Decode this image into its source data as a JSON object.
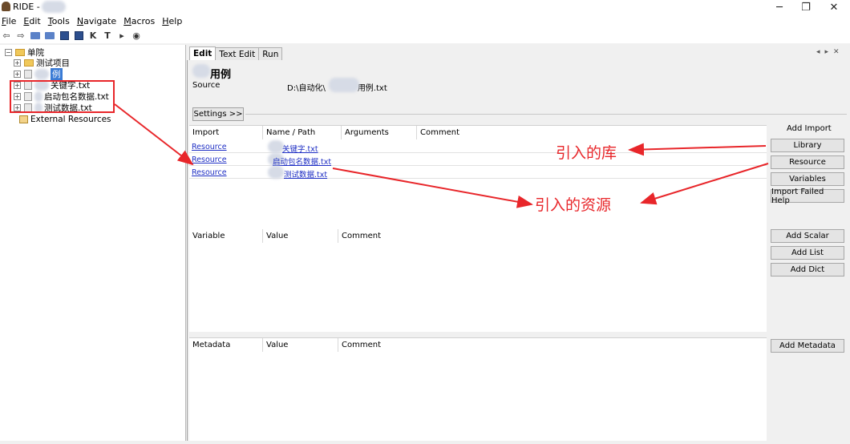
{
  "window": {
    "title": "RIDE - ",
    "controls": [
      "minimize-icon",
      "restore-icon",
      "close-icon"
    ]
  },
  "menu": {
    "items": [
      {
        "label": "File",
        "key": "F",
        "rest": "ile"
      },
      {
        "label": "Edit",
        "key": "E",
        "rest": "dit"
      },
      {
        "label": "Tools",
        "key": "T",
        "rest": "ools"
      },
      {
        "label": "Navigate",
        "key": "N",
        "rest": "avigate"
      },
      {
        "label": "Macros",
        "key": "M",
        "rest": "acros"
      },
      {
        "label": "Help",
        "key": "H",
        "rest": "elp"
      }
    ]
  },
  "tree": {
    "root": "单院",
    "folder": "测试项目",
    "selected": "例",
    "files": [
      "关键字.txt",
      "启动包名数据.txt",
      "测试数据.txt"
    ],
    "external": "External Resources"
  },
  "tabs": [
    "Edit",
    "Text Edit",
    "Run"
  ],
  "editor": {
    "title": "用例",
    "source_label": "Source",
    "source_path": "D:\\自动化\\",
    "source_path_suffix": "用例.txt",
    "settings_button": "Settings >>"
  },
  "imports": {
    "headers": [
      "Import",
      "Name / Path",
      "Arguments",
      "Comment"
    ],
    "rows": [
      {
        "type": "Resource",
        "path": "关键字.txt"
      },
      {
        "type": "Resource",
        "path": "启动包名数据.txt"
      },
      {
        "type": "Resource",
        "path": "测试数据.txt"
      }
    ]
  },
  "variables": {
    "headers": [
      "Variable",
      "Value",
      "Comment"
    ]
  },
  "metadata": {
    "headers": [
      "Metadata",
      "Value",
      "Comment"
    ]
  },
  "buttons": {
    "add_import_label": "Add Import",
    "library": "Library",
    "resource": "Resource",
    "variables": "Variables",
    "import_failed_help": "Import Failed Help",
    "add_scalar": "Add Scalar",
    "add_list": "Add List",
    "add_dict": "Add Dict",
    "add_metadata": "Add Metadata"
  },
  "annotations": {
    "library_note": "引入的库",
    "resource_note": "引入的资源"
  },
  "colors": {
    "annotation_red": "#e8262a",
    "link_blue": "#1f2fc4",
    "selection_blue": "#3a7bd5"
  }
}
